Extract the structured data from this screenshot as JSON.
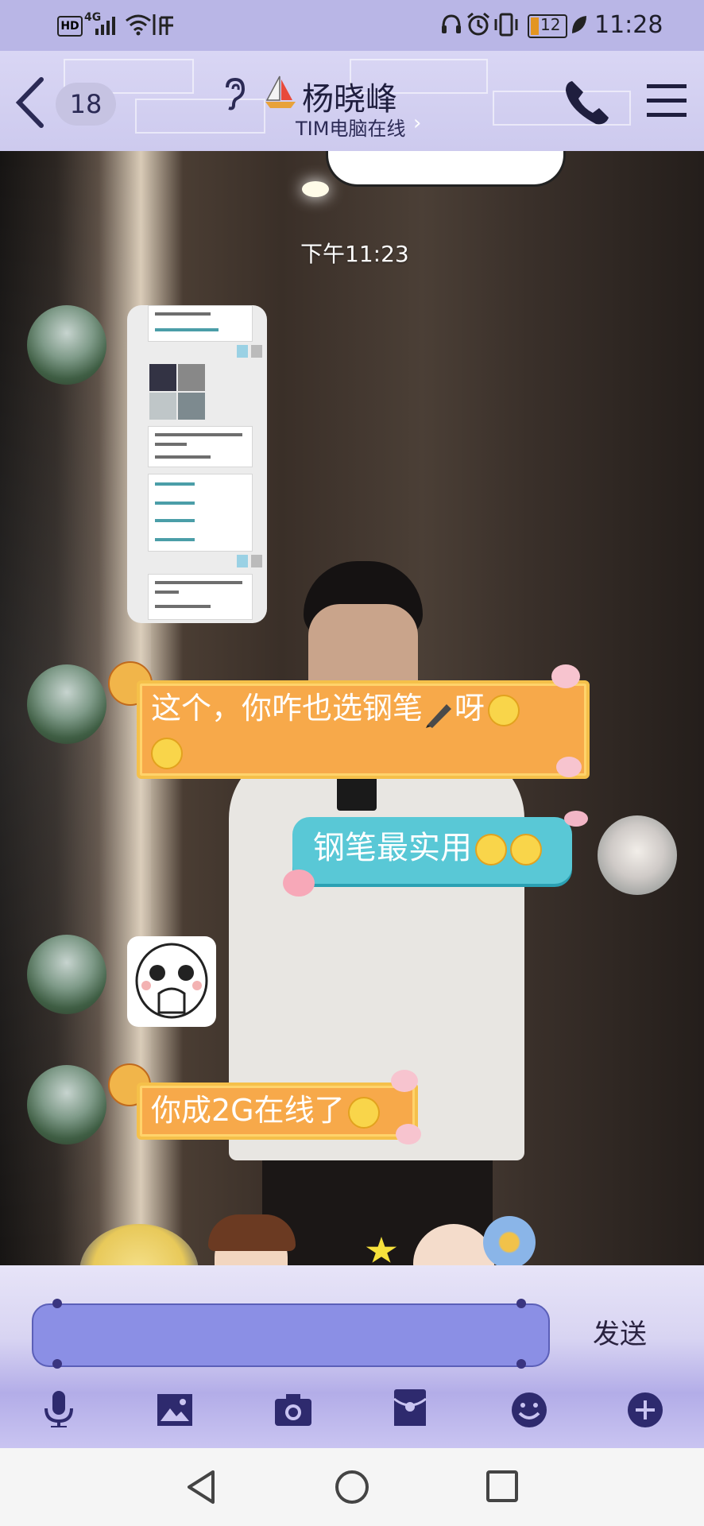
{
  "status_bar": {
    "left_icons": [
      "hd-icon",
      "signal-4g-icon",
      "wifi-icon",
      "listen-icon"
    ],
    "hd": "HD",
    "net": "4G",
    "battery": "12",
    "time": "11:28"
  },
  "header": {
    "back_badge": "18",
    "contact_name": "杨晓峰",
    "contact_status": "TIM电脑在线",
    "status_chevron": "›"
  },
  "chat": {
    "timestamp": "下午11:23",
    "messages": [
      {
        "side": "left",
        "type": "image"
      },
      {
        "side": "left",
        "type": "text",
        "text_line1": "这个，你咋也选钢笔",
        "text_line1b": "呀"
      },
      {
        "side": "right",
        "type": "text",
        "text": "钢笔最实用"
      },
      {
        "side": "left",
        "type": "sticker"
      },
      {
        "side": "left",
        "type": "text",
        "text": "你成2G在线了"
      }
    ]
  },
  "input": {
    "value": "",
    "send_label": "发送"
  },
  "toolbar": {
    "items": [
      "microphone-icon",
      "image-icon",
      "camera-icon",
      "red-packet-icon",
      "emoji-icon",
      "plus-icon"
    ]
  },
  "nav": {
    "items": [
      "back-triangle-icon",
      "home-circle-icon",
      "recent-square-icon"
    ]
  }
}
